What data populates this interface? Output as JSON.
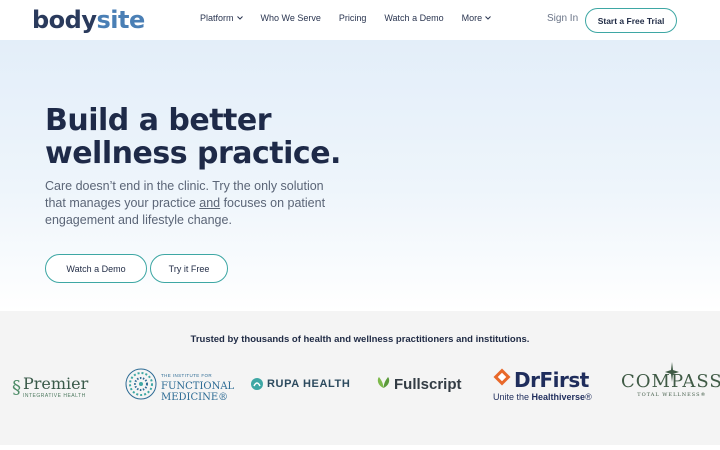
{
  "nav": {
    "logo_text_body": "body",
    "logo_text_site": "site",
    "links": [
      {
        "label": "Platform",
        "has_chevron": true
      },
      {
        "label": "Who We Serve",
        "has_chevron": false
      },
      {
        "label": "Pricing",
        "has_chevron": false
      },
      {
        "label": "Watch a Demo",
        "has_chevron": false
      },
      {
        "label": "More",
        "has_chevron": true
      }
    ],
    "signin_label": "Sign In",
    "cta_label": "Start a Free Trial"
  },
  "hero": {
    "title": "Build a better wellness practice.",
    "body_before": "Care doesn’t end in the clinic. Try the only solution that manages your practice ",
    "body_underlined": "and",
    "body_after": " focuses on patient engagement and lifestyle change.",
    "demo_button": "Watch a Demo",
    "try_button": "Try it Free"
  },
  "trusted": {
    "heading": "Trusted by thousands of health and wellness practitioners and institutions.",
    "logos": {
      "premier_name": "Premier",
      "premier_sub": "INTEGRATIVE HEALTH",
      "ifm_small": "THE INSTITUTE FOR",
      "ifm_line1": "FUNCTIONAL",
      "ifm_line2": "MEDICINE®",
      "rupa": "RUPA HEALTH",
      "fullscript": "Fullscript",
      "drfirst_name": "DrFirst",
      "drfirst_tag_prefix": "Unite the ",
      "drfirst_tag_bold": "Healthiverse",
      "drfirst_tag_suffix": "®",
      "compass_name": "COMPASS",
      "compass_sub": "TOTAL WELLNESS®"
    }
  },
  "colors": {
    "brand_navy": "#1e2a48",
    "accent_teal": "#3ea7a4",
    "logo_blue": "#4a7fb5",
    "section_gray": "#f4f4f4"
  },
  "icons": [
    "chevron-down-icon",
    "ifm-emblem-icon",
    "rupa-mark-icon",
    "fullscript-leaf-icon",
    "drfirst-diamond-icon",
    "compass-star-icon"
  ]
}
